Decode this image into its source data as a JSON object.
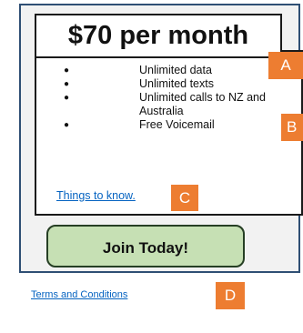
{
  "plan": {
    "price_title": "$70 per month",
    "features": [
      "Unlimited data",
      "Unlimited texts",
      "Unlimited calls to NZ and Australia",
      "Free Voicemail"
    ],
    "things_link": "Things to know.",
    "join_button": "Join Today!"
  },
  "footer": {
    "terms_link": "Terms and Conditions"
  },
  "markers": {
    "a": "A",
    "b": "B",
    "c": "C",
    "d": "D"
  },
  "colors": {
    "card_border": "#2f4f74",
    "card_background": "#f2f2f2",
    "button_fill": "#c6e0b4",
    "marker_fill": "#ed7d31",
    "link": "#0563c1"
  },
  "icons": {
    "list_bullet": "bullet-icon"
  }
}
